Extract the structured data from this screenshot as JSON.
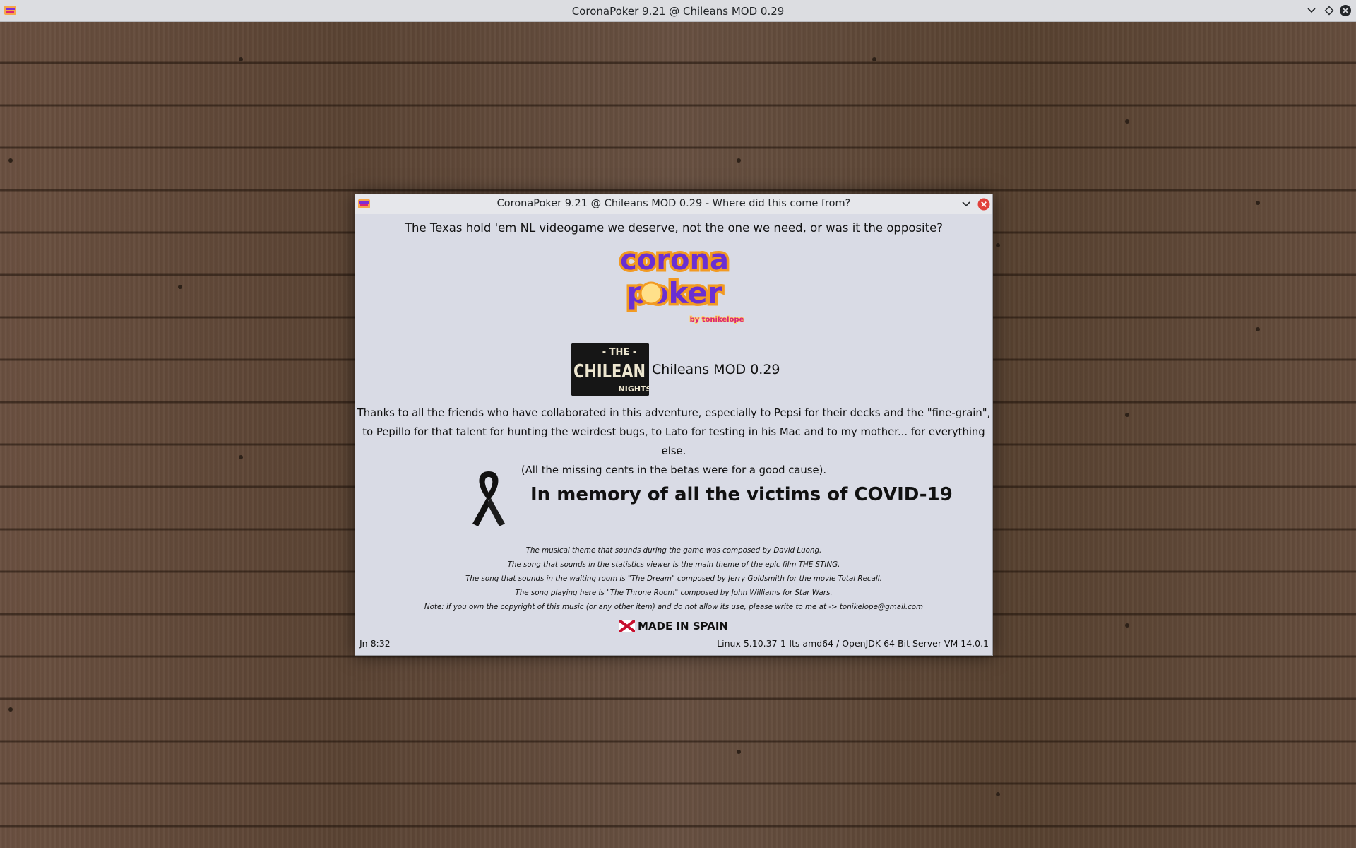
{
  "window": {
    "title": "CoronaPoker 9.21 @ Chileans MOD 0.29",
    "icon": "coronapoker-app-icon"
  },
  "dialog": {
    "title": "CoronaPoker 9.21 @ Chileans MOD 0.29 - Where did this come from?",
    "tagline": "The Texas hold 'em NL videogame we deserve, not the one we need, or was it the opposite?",
    "logo": {
      "line1": "corona",
      "line2": "poker",
      "byline": "by tonikelope"
    },
    "chilean_badge": {
      "top": "- THE -",
      "middle": "CHILEAN",
      "bottom": "NIGHTS"
    },
    "mod_label": "Chileans MOD 0.29",
    "thanks_lines": [
      "Thanks to all the friends who have collaborated in this adventure, especially to Pepsi for their decks and the \"fine-grain\",",
      "to Pepillo for that talent for hunting the weirdest bugs, to Lato for testing in his Mac and to my mother... for everything else.",
      "(All the missing cents in the betas were for a good cause)."
    ],
    "memory_text": "In memory of all the victims of COVID-19",
    "credits_lines": [
      "The musical theme that sounds during the game was composed by David Luong.",
      "The song that sounds in the statistics viewer is the main theme of the epic film THE STING.",
      "The song that sounds in the waiting room is \"The Dream\" composed by Jerry Goldsmith for the movie Total Recall.",
      "The song playing here is \"The Throne Room\" composed by John Williams for Star Wars.",
      "Note: if you own the copyright of this music (or any other item) and do not allow its use, please write to me at -> tonikelope@gmail.com"
    ],
    "made_in": "MADE IN SPAIN",
    "footer_left": "Jn 8:32",
    "footer_right": "Linux 5.10.37-1-lts amd64 / OpenJDK 64-Bit Server VM 14.0.1"
  },
  "colors": {
    "background_wood": "#5e4737",
    "dialog_body": "#d9dbe5",
    "close_button": "#e0403a",
    "logo_fill": "#6a2fd3",
    "logo_outline": "#f29a22"
  }
}
